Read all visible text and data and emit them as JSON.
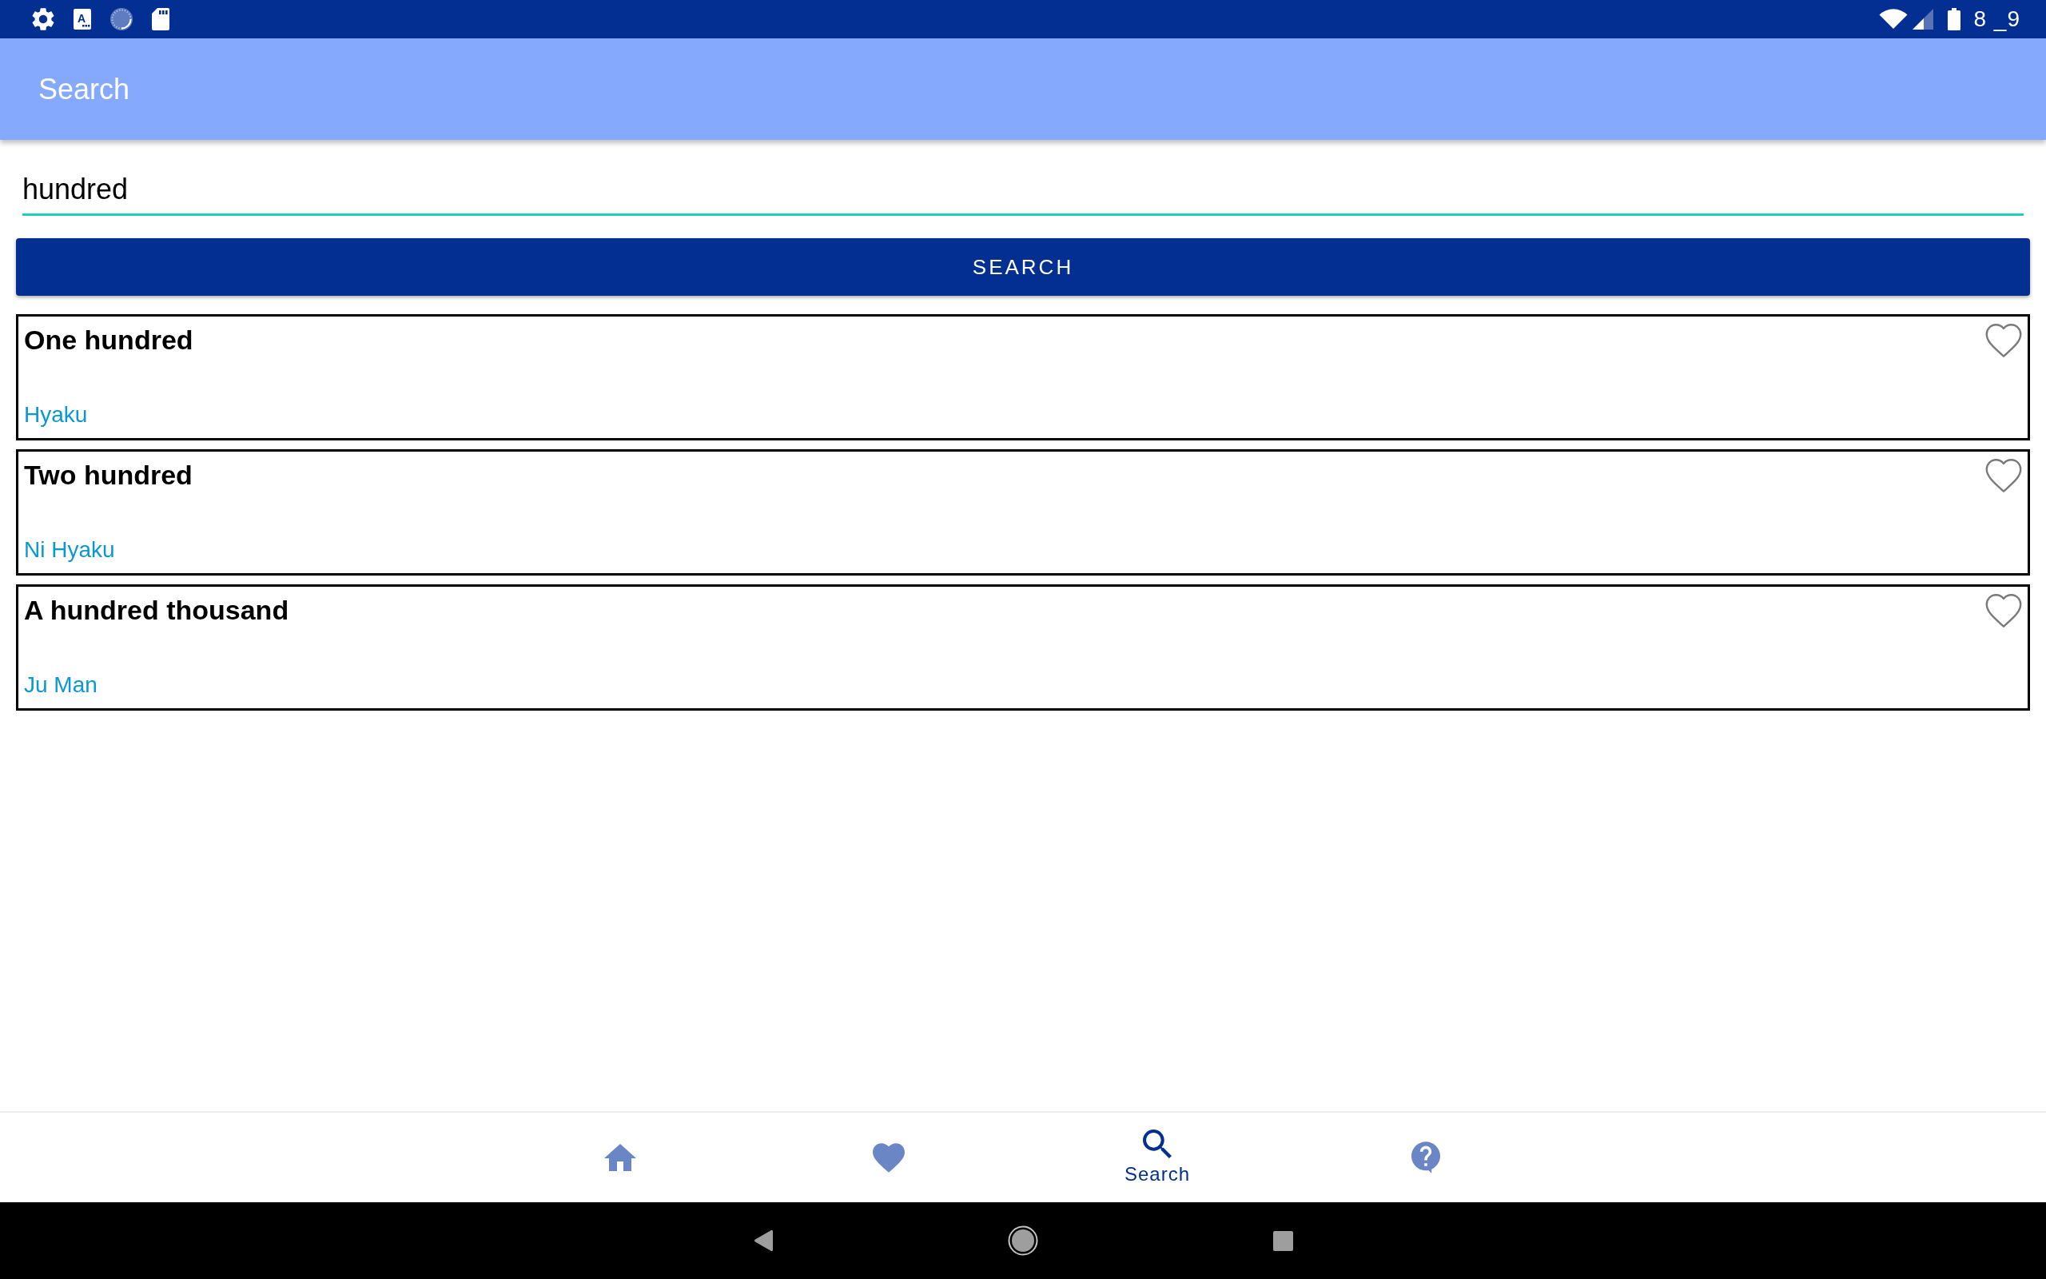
{
  "status_bar": {
    "notification_icons": [
      {
        "kind": "settings"
      },
      {
        "kind": "app",
        "label": "A"
      },
      {
        "kind": "sync"
      },
      {
        "kind": "sd_card"
      }
    ],
    "time": "8 _9"
  },
  "app_bar": {
    "title": "Search"
  },
  "search": {
    "value": "hundred",
    "button": "SEARCH"
  },
  "results": [
    {
      "title": "One hundred",
      "reading": "Hyaku",
      "favorite": false
    },
    {
      "title": "Two hundred",
      "reading": "Ni Hyaku",
      "favorite": false
    },
    {
      "title": "A hundred thousand",
      "reading": "Ju Man",
      "favorite": false
    }
  ],
  "bottom_nav": [
    {
      "kind": "home",
      "selected": false
    },
    {
      "kind": "favorites",
      "selected": false
    },
    {
      "kind": "search",
      "label": "Search",
      "selected": true
    },
    {
      "kind": "help",
      "selected": false
    }
  ]
}
